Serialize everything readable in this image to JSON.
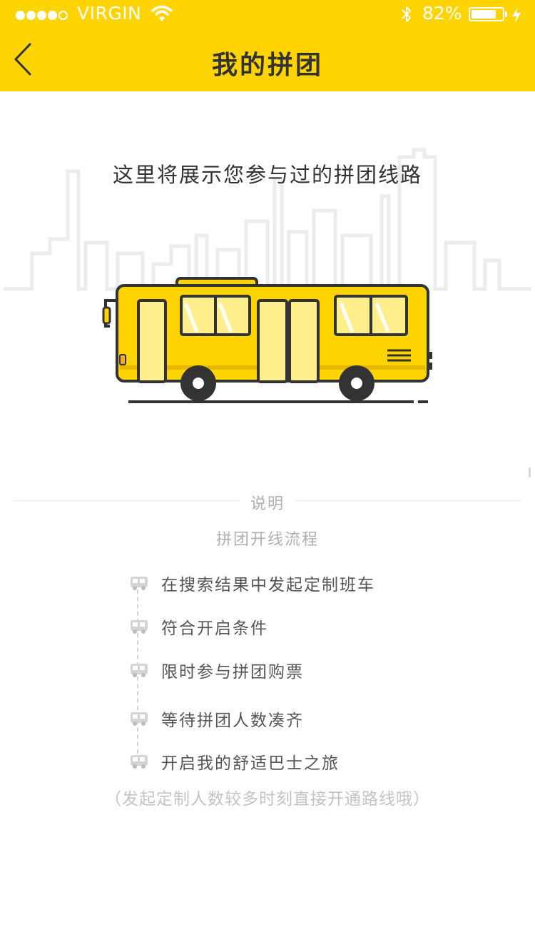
{
  "status_bar": {
    "signal_filled": 4,
    "signal_empty": 1,
    "carrier": "VIRGIN",
    "battery_percent": "82%",
    "battery_level": 0.82
  },
  "nav": {
    "title": "我的拼团",
    "back_icon": "chevron-left-icon"
  },
  "empty_state": {
    "message": "这里将展示您参与过的拼团线路"
  },
  "instructions": {
    "section_title": "说明",
    "process_title": "拼团开线流程",
    "steps": [
      {
        "label": "在搜索结果中发起定制班车",
        "icon": "bus-icon"
      },
      {
        "label": "符合开启条件",
        "icon": "bus-icon"
      },
      {
        "label": "限时参与拼团购票",
        "icon": "bus-icon"
      },
      {
        "label": "等待拼团人数凑齐",
        "icon": "bus-icon"
      },
      {
        "label": "开启我的舒适巴士之旅",
        "icon": "bus-icon"
      }
    ],
    "note": "（发起定制人数较多时刻直接开通路线哦）"
  },
  "colors": {
    "brand_yellow": "#FFD400",
    "bus_body": "#FFD400",
    "bus_window": "#FFEF8C",
    "text_dark": "#333333",
    "text_muted": "#B0B0B0"
  }
}
